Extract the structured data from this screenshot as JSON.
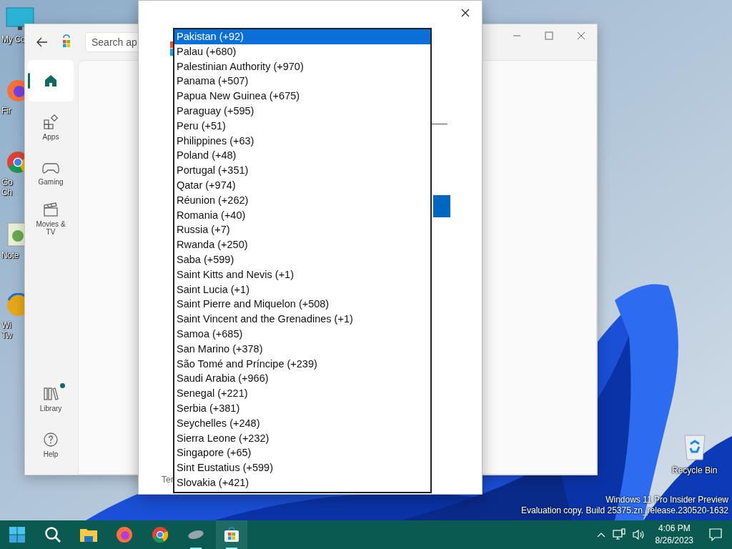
{
  "desktop_icons": [
    {
      "kind": "computer",
      "label_lines": [
        "My Co"
      ]
    },
    {
      "kind": "firefox",
      "label_lines": [
        "Fir"
      ]
    },
    {
      "kind": "chrome",
      "label_lines": [
        "Go",
        "Ch"
      ]
    },
    {
      "kind": "notepad",
      "label_lines": [
        "Note"
      ]
    },
    {
      "kind": "tweaker",
      "label_lines": [
        "Wi",
        "Tw"
      ]
    }
  ],
  "recycle_bin": {
    "label": "Recycle Bin"
  },
  "store_window": {
    "search": {
      "placeholder": "Search ap"
    },
    "nav": [
      {
        "kind": "home",
        "selected": true,
        "badge": false
      },
      {
        "kind": "apps",
        "label": "Apps",
        "selected": false,
        "badge": false
      },
      {
        "kind": "gaming",
        "label": "Gaming",
        "selected": false,
        "badge": false
      },
      {
        "kind": "movies",
        "label": "Movies & TV",
        "selected": false,
        "badge": false
      }
    ],
    "nav_bottom": [
      {
        "kind": "library",
        "label": "Library",
        "selected": false,
        "badge": true
      },
      {
        "kind": "help",
        "label": "Help",
        "selected": false,
        "badge": false
      }
    ]
  },
  "dialog": {
    "footer_text": "Ter",
    "country_list": [
      {
        "label": "Pakistan (+92)",
        "selected": true
      },
      {
        "label": "Palau (+680)",
        "selected": false
      },
      {
        "label": "Palestinian Authority (+970)",
        "selected": false
      },
      {
        "label": "Panama (+507)",
        "selected": false
      },
      {
        "label": "Papua New Guinea (+675)",
        "selected": false
      },
      {
        "label": "Paraguay (+595)",
        "selected": false
      },
      {
        "label": "Peru (+51)",
        "selected": false
      },
      {
        "label": "Philippines (+63)",
        "selected": false
      },
      {
        "label": "Poland (+48)",
        "selected": false
      },
      {
        "label": "Portugal (+351)",
        "selected": false
      },
      {
        "label": "Qatar (+974)",
        "selected": false
      },
      {
        "label": "Réunion (+262)",
        "selected": false
      },
      {
        "label": "Romania (+40)",
        "selected": false
      },
      {
        "label": "Russia (+7)",
        "selected": false
      },
      {
        "label": "Rwanda (+250)",
        "selected": false
      },
      {
        "label": "Saba (+599)",
        "selected": false
      },
      {
        "label": "Saint Kitts and Nevis (+1)",
        "selected": false
      },
      {
        "label": "Saint Lucia (+1)",
        "selected": false
      },
      {
        "label": "Saint Pierre and Miquelon (+508)",
        "selected": false
      },
      {
        "label": "Saint Vincent and the Grenadines (+1)",
        "selected": false
      },
      {
        "label": "Samoa (+685)",
        "selected": false
      },
      {
        "label": "San Marino (+378)",
        "selected": false
      },
      {
        "label": "São Tomé and Príncipe (+239)",
        "selected": false
      },
      {
        "label": "Saudi Arabia (+966)",
        "selected": false
      },
      {
        "label": "Senegal (+221)",
        "selected": false
      },
      {
        "label": "Serbia (+381)",
        "selected": false
      },
      {
        "label": "Seychelles (+248)",
        "selected": false
      },
      {
        "label": "Sierra Leone (+232)",
        "selected": false
      },
      {
        "label": "Singapore (+65)",
        "selected": false
      },
      {
        "label": "Sint Eustatius (+599)",
        "selected": false
      },
      {
        "label": "Slovakia (+421)",
        "selected": false
      }
    ]
  },
  "os_build_notice": [
    "Windows 11 Pro Insider Preview",
    "Evaluation copy. Build 25375.zn_release.230520-1632"
  ],
  "taskbar": {
    "apps": [
      {
        "kind": "start",
        "selected": false,
        "running": false
      },
      {
        "kind": "search",
        "selected": false,
        "running": false
      },
      {
        "kind": "explorer",
        "selected": false,
        "running": false
      },
      {
        "kind": "firefox",
        "selected": false,
        "running": false
      },
      {
        "kind": "chrome",
        "selected": false,
        "running": false
      },
      {
        "kind": "mouse",
        "selected": false,
        "running": true
      },
      {
        "kind": "store",
        "selected": true,
        "running": true
      }
    ],
    "time": "4:06 PM",
    "date": "8/26/2023"
  }
}
